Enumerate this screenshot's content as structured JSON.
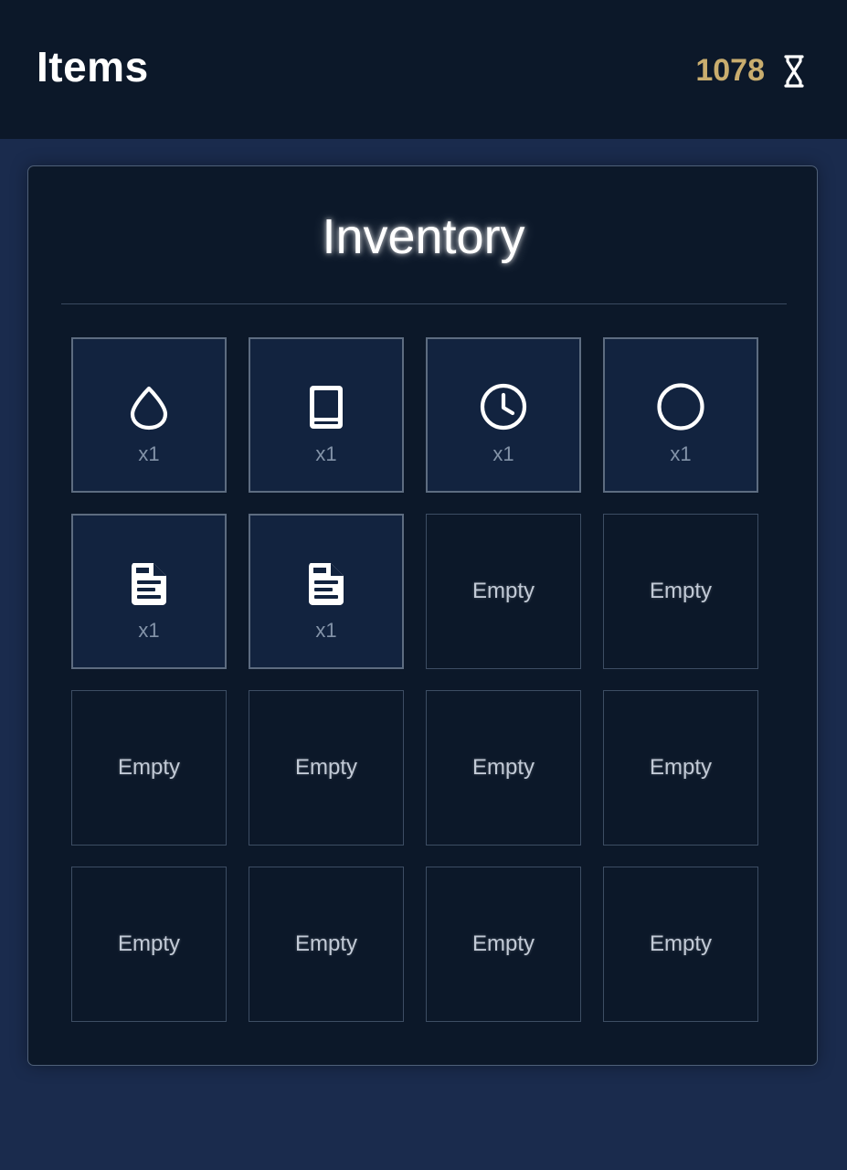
{
  "header": {
    "title": "Items",
    "counter_value": "1078",
    "counter_icon": "hourglass-icon"
  },
  "inventory": {
    "title": "Inventory",
    "slots": [
      {
        "icon": "water-drop-icon",
        "quantity": "x1"
      },
      {
        "icon": "book-icon",
        "quantity": "x1"
      },
      {
        "icon": "clock-icon",
        "quantity": "x1"
      },
      {
        "icon": "circle-icon",
        "quantity": "x1"
      },
      {
        "icon": "document-icon",
        "quantity": "x1"
      },
      {
        "icon": "document-icon",
        "quantity": "x1"
      },
      {
        "empty_label": "Empty"
      },
      {
        "empty_label": "Empty"
      },
      {
        "empty_label": "Empty"
      },
      {
        "empty_label": "Empty"
      },
      {
        "empty_label": "Empty"
      },
      {
        "empty_label": "Empty"
      },
      {
        "empty_label": "Empty"
      },
      {
        "empty_label": "Empty"
      },
      {
        "empty_label": "Empty"
      },
      {
        "empty_label": "Empty"
      }
    ]
  },
  "colors": {
    "page_background": "#1a2b4d",
    "header_background": "#0c1829",
    "panel_background": "#0c1829",
    "filled_slot_background": "#12233f",
    "counter_accent": "#c9ad6e"
  }
}
